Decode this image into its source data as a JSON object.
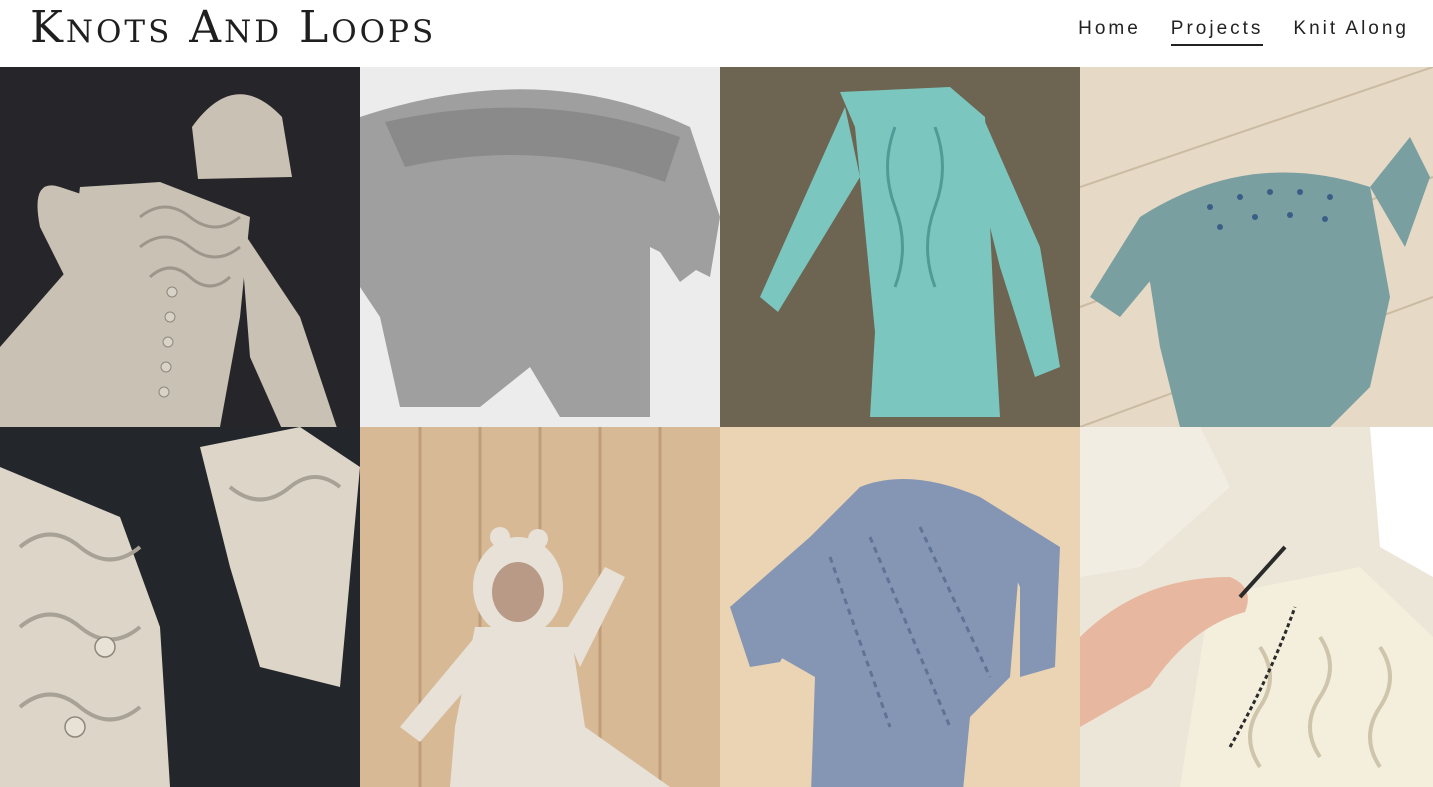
{
  "site": {
    "title": "Knots And Loops"
  },
  "nav": {
    "items": [
      {
        "label": "Home",
        "active": false
      },
      {
        "label": "Projects",
        "active": true
      },
      {
        "label": "Knit Along",
        "active": false
      }
    ]
  },
  "gallery": {
    "items": [
      {
        "subject": "cream cabled baby romper with cabled hat",
        "background": "#26262a",
        "garment": "#c9c1b4"
      },
      {
        "subject": "grey knitted baby romper with round yoke",
        "background": "#ececec",
        "garment": "#9f9f9f"
      },
      {
        "subject": "aqua cabled sweater and skirt",
        "background": "#6d6552",
        "garment": "#7cc6c0"
      },
      {
        "subject": "teal baby romper with beaded yoke",
        "background": "#e6d9c5",
        "garment": "#7a9fa1"
      },
      {
        "subject": "close-up of cream cabled cardigan and hat",
        "background": "#23262b",
        "garment": "#ddd5c8"
      },
      {
        "subject": "cream hooded baby suit with bear ears",
        "background": "#d8b996",
        "garment": "#e7e1d8"
      },
      {
        "subject": "blue lace sweater",
        "background": "#ead4b3",
        "garment": "#8596b4"
      },
      {
        "subject": "hand knitting cream cabled piece on needles",
        "background": "#ece6d8",
        "garment": "#f4eedc"
      }
    ]
  },
  "colors": {
    "text": "#1f1f1f",
    "header_background": "#ffffff",
    "skin": "#e7b79f",
    "needle": "#2a2a2a"
  }
}
